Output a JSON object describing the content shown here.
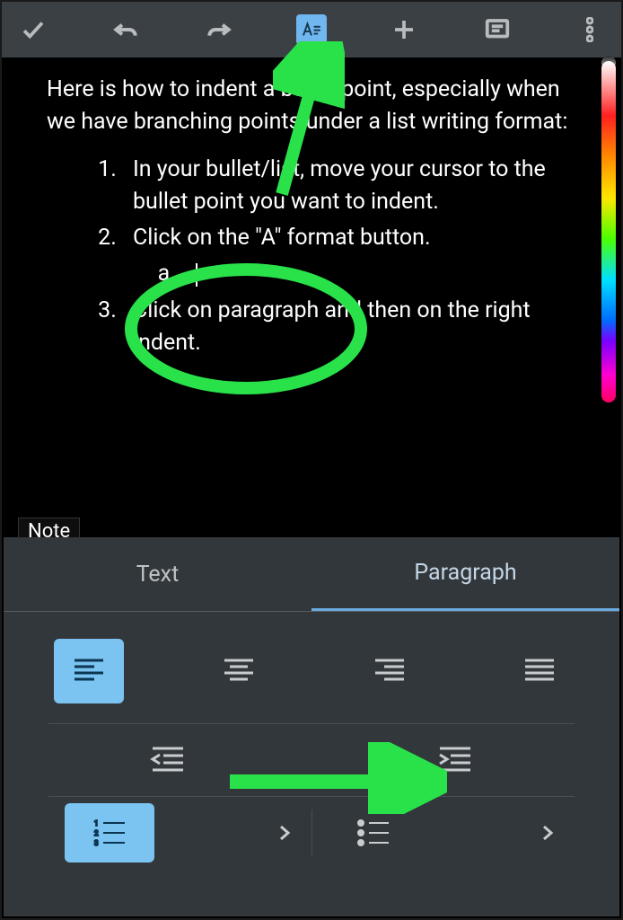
{
  "annotations": {
    "color": "#29e24a"
  },
  "doc": {
    "intro": "Here is how to indent a bullet point, especially when we have branching points under a list writing format:",
    "items": [
      "In your bullet/list, move your cursor to the bullet point you want to indent.",
      "Click on the \"A\" format button.",
      "Click on paragraph and then on the right indent."
    ],
    "subitem": ""
  },
  "notetab": {
    "label": "Note"
  },
  "panel": {
    "tabs": {
      "text": "Text",
      "paragraph": "Paragraph"
    },
    "active_tab": "paragraph",
    "alignment_active": "left",
    "list_numbered_active": true
  }
}
